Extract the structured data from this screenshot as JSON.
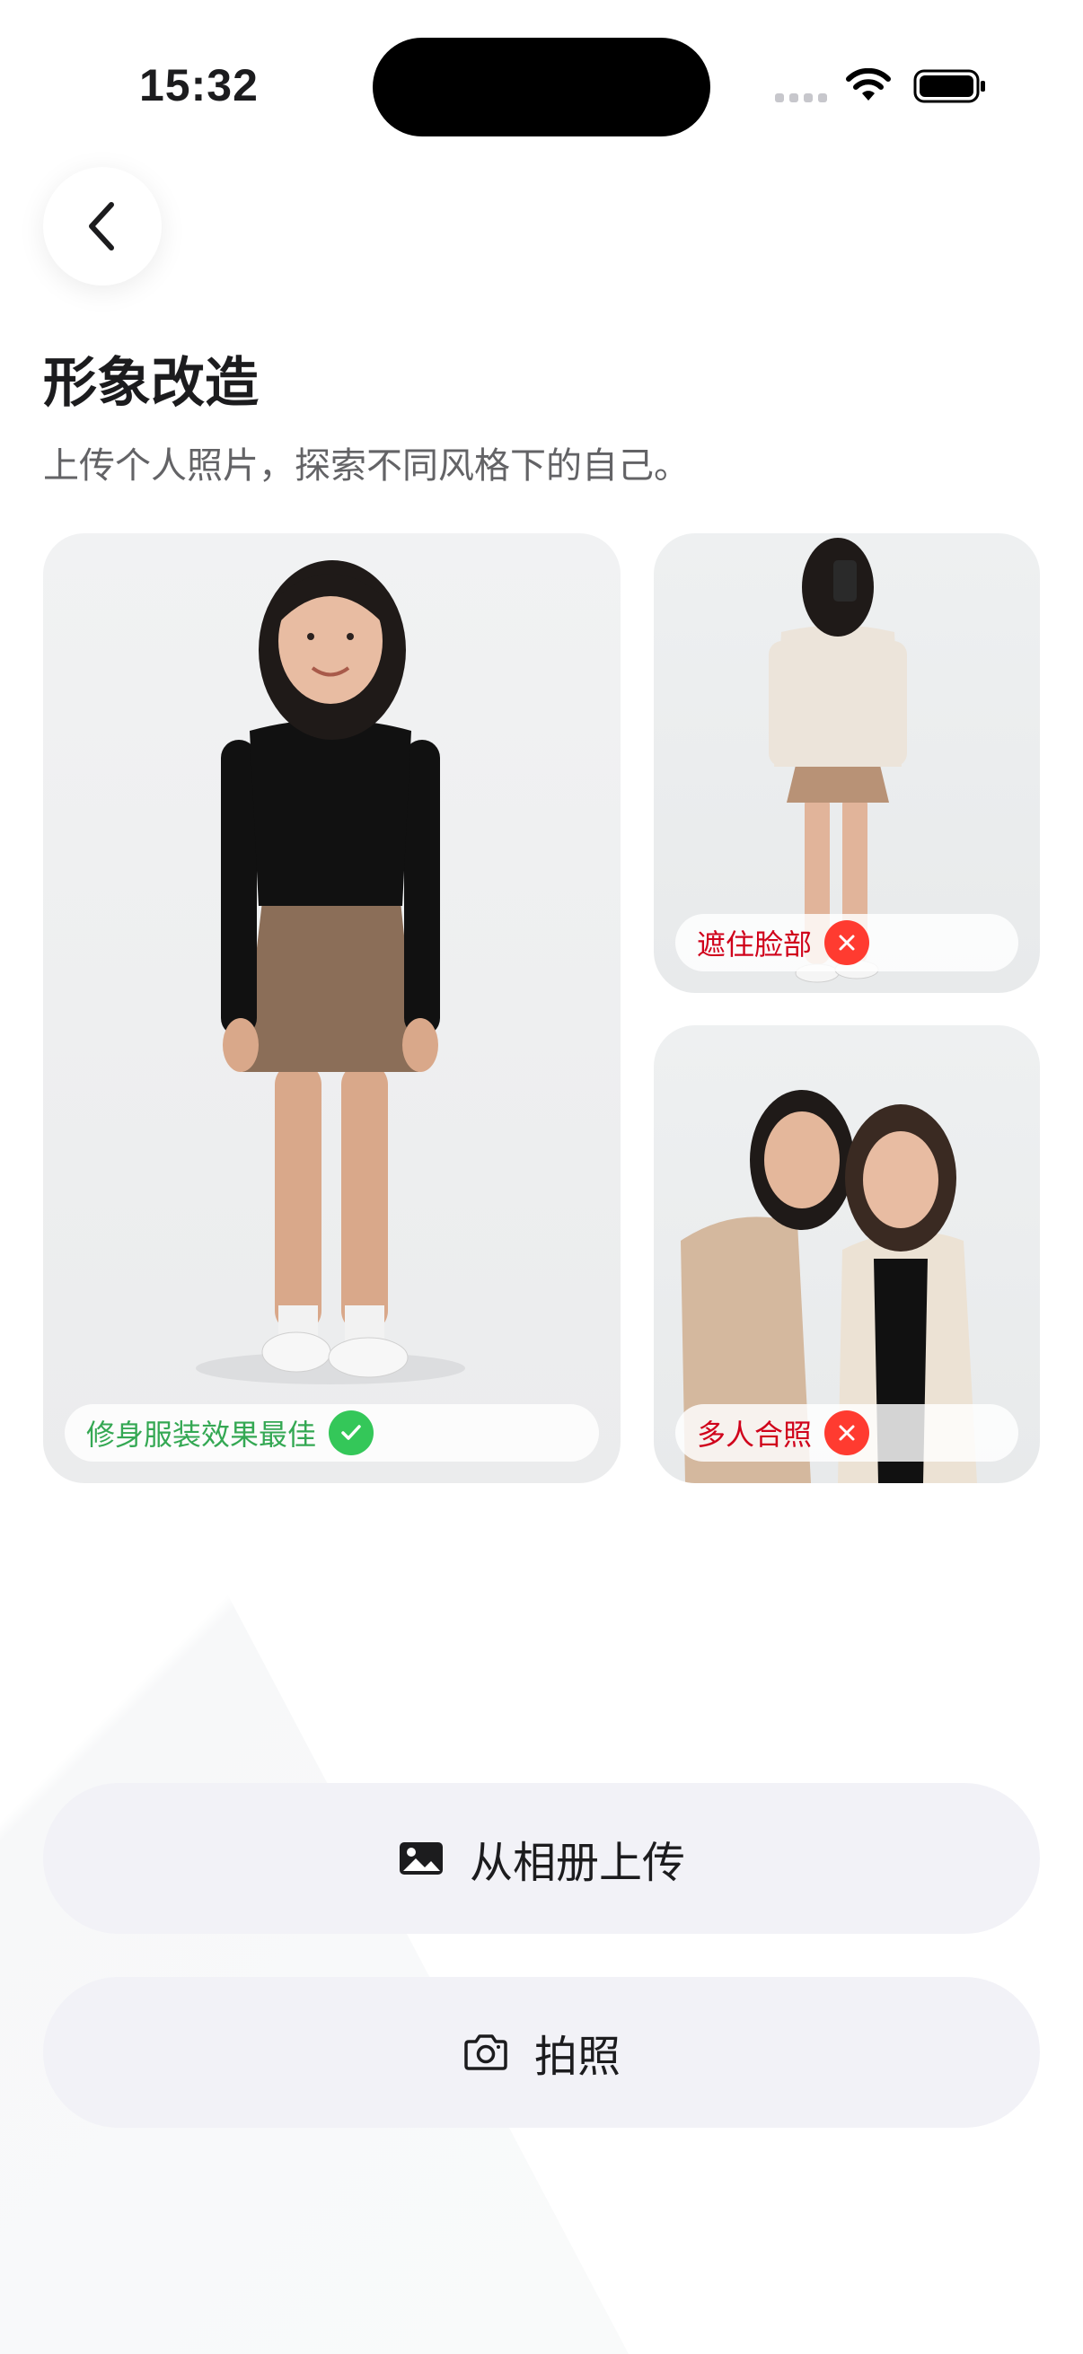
{
  "status_bar": {
    "time": "15:32"
  },
  "header": {
    "title": "形象改造",
    "subtitle": "上传个人照片，探索不同风格下的自己。"
  },
  "examples": [
    {
      "label": "修身服装效果最佳",
      "status": "good",
      "status_color": "#34c759"
    },
    {
      "label": "遮住脸部",
      "status": "bad",
      "status_color": "#ff3b30"
    },
    {
      "label": "多人合照",
      "status": "bad",
      "status_color": "#ff3b30"
    }
  ],
  "actions": {
    "upload_label": "从相册上传",
    "upload_icon": "photo-icon",
    "camera_label": "拍照",
    "camera_icon": "camera-icon"
  }
}
